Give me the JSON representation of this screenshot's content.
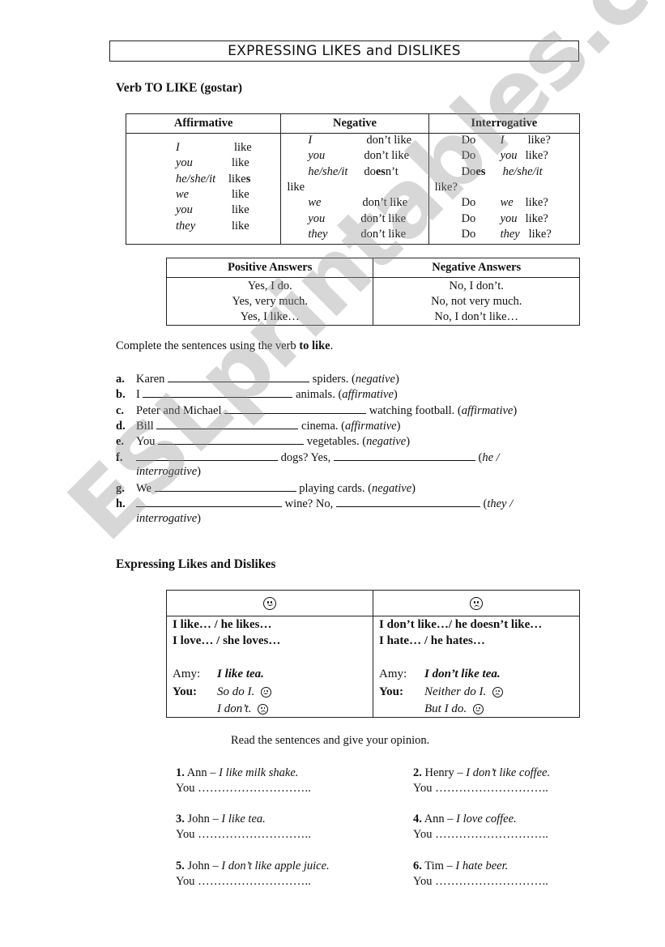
{
  "title": "EXPRESSING LIKES and DISLIKES",
  "section1_heading": "Verb TO LIKE (gostar)",
  "conjugation": {
    "headers": [
      "Affirmative",
      "Negative",
      "Interrogative"
    ],
    "affirmative": [
      {
        "pronoun": "I",
        "verb": "like"
      },
      {
        "pronoun": "you",
        "verb": "like"
      },
      {
        "pronoun": "he/she/it",
        "verb": "like",
        "verb_bold": "s"
      },
      {
        "pronoun": "we",
        "verb": "like"
      },
      {
        "pronoun": "you",
        "verb": "like"
      },
      {
        "pronoun": "they",
        "verb": "like"
      }
    ],
    "negative": [
      {
        "pronoun": "I",
        "verb": "don’t like"
      },
      {
        "pronoun": "you",
        "verb": "don’t like"
      },
      {
        "pronoun": "he/she/it",
        "verb_pre": "do",
        "verb_bold": "es",
        "verb_post": "n’t",
        "wrap": "like"
      },
      {
        "pronoun": "we",
        "verb": "don’t like"
      },
      {
        "pronoun": "you",
        "verb": "don’t like"
      },
      {
        "pronoun": "they",
        "verb": "don’t like"
      }
    ],
    "interrogative": [
      {
        "aux": "Do",
        "pronoun": "I",
        "verb": "like?"
      },
      {
        "aux": "Do",
        "pronoun": "you",
        "verb": "like?"
      },
      {
        "aux_pre": "Do",
        "aux_bold": "es",
        "pronoun": "he/she/it",
        "wrap": "like?"
      },
      {
        "aux": "Do",
        "pronoun": "we",
        "verb": "like?"
      },
      {
        "aux": "Do",
        "pronoun": "you",
        "verb": "like?"
      },
      {
        "aux": "Do",
        "pronoun": "they",
        "verb": "like?"
      }
    ]
  },
  "answers": {
    "headers": [
      "Positive Answers",
      "Negative Answers"
    ],
    "positive": [
      "Yes, I do.",
      "Yes, very much.",
      "Yes, I like…"
    ],
    "negative": [
      "No, I don’t.",
      "No, not very much.",
      "No, I don’t like…"
    ]
  },
  "exercise1": {
    "instruction_pre": "Complete the sentences using the verb ",
    "instruction_bold": "to like",
    "instruction_post": ".",
    "items": [
      {
        "label": "a.",
        "pre": "Karen ",
        "post": " spiders. (",
        "hint": "negative",
        "end": ")"
      },
      {
        "label": "b.",
        "pre": "I ",
        "post": " animals. (",
        "hint": "affirmative",
        "end": ")"
      },
      {
        "label": "c.",
        "pre": "Peter and Michael ",
        "post": " watching football. (",
        "hint": "affirmative",
        "end": ")"
      },
      {
        "label": "d.",
        "pre": "Bill ",
        "post": " cinema. (",
        "hint": "affirmative",
        "end": ")"
      },
      {
        "label": "e.",
        "pre": "You ",
        "post": " vegetables. (",
        "hint": "negative",
        "end": ")"
      },
      {
        "label": "f.",
        "pre": "",
        "post": " dogs? Yes, ",
        "post2": " (",
        "hint": "he /",
        "hint2": "interrogative",
        "end": ")"
      },
      {
        "label": "g.",
        "pre": "We ",
        "post": " playing cards. (",
        "hint": "negative",
        "end": ")"
      },
      {
        "label": "h.",
        "pre": "",
        "post": " wine? No, ",
        "post2": " (",
        "hint": "they /",
        "hint2": "interrogative",
        "end": ")"
      }
    ]
  },
  "section2_heading": "Expressing Likes and Dislikes",
  "likes_table": {
    "left_icon": "smiley-face-icon",
    "right_icon": "sad-face-icon",
    "left": {
      "line1": "I like… / he likes…",
      "line2": "I love… / she loves…",
      "amy_label": "Amy:",
      "amy_text": "I like tea.",
      "you_label": "You:",
      "reply1": "So do I.",
      "reply2": "I don’t."
    },
    "right": {
      "line1": "I don’t like…/ he doesn’t like…",
      "line2": "I hate… / he hates…",
      "amy_label": "Amy:",
      "amy_text": "I don’t like tea.",
      "you_label": "You:",
      "reply1": "Neither do I.",
      "reply2": "But I do."
    }
  },
  "exercise2": {
    "instruction": "Read the sentences and give your opinion.",
    "items": [
      {
        "num": "1.",
        "name": "Ann – ",
        "quote": "I like milk shake.",
        "you": "You",
        "dots": "……………………….."
      },
      {
        "num": "2.",
        "name": "Henry – ",
        "quote": "I don’t like coffee.",
        "you": "You",
        "dots": "……………………….."
      },
      {
        "num": "3.",
        "name": "John – ",
        "quote": "I like tea.",
        "you": "You",
        "dots": "……………………….."
      },
      {
        "num": "4.",
        "name": "Ann – ",
        "quote": "I love coffee.",
        "you": "You",
        "dots": "……………………….."
      },
      {
        "num": "5.",
        "name": "John – ",
        "quote": "I don’t like apple juice.",
        "you": "You",
        "dots": "……………………….."
      },
      {
        "num": "6.",
        "name": "Tim – ",
        "quote": "I hate beer.",
        "you": "You",
        "dots": "……………………….."
      }
    ]
  },
  "watermark": "ESLprintables.com"
}
